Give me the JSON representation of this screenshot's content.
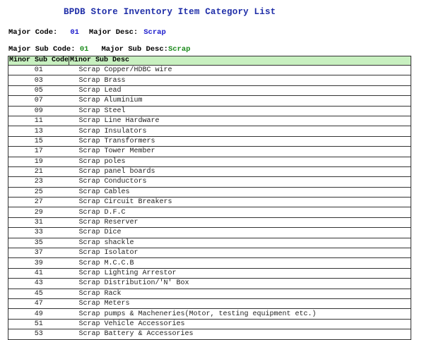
{
  "title": "BPDB Store Inventory Item Category List",
  "major": {
    "code_label": "Major Code:",
    "code": "01",
    "desc_label": "Major Desc:",
    "desc": "Scrap"
  },
  "major_sub": {
    "code_label": "Major Sub Code:",
    "code": "01",
    "desc_label": "Major Sub Desc:",
    "desc": "Scrap"
  },
  "table": {
    "headers": [
      "Minor Sub Code",
      "Minor Sub Desc"
    ],
    "rows": [
      {
        "code": "01",
        "desc": "Scrap Copper/HDBC wire"
      },
      {
        "code": "03",
        "desc": "Scrap Brass"
      },
      {
        "code": "05",
        "desc": "Scrap Lead"
      },
      {
        "code": "07",
        "desc": "Scrap Aluminium"
      },
      {
        "code": "09",
        "desc": "Scrap Steel"
      },
      {
        "code": "11",
        "desc": "Scrap Line Hardware"
      },
      {
        "code": "13",
        "desc": "Scrap Insulators"
      },
      {
        "code": "15",
        "desc": "Scrap Transformers"
      },
      {
        "code": "17",
        "desc": "Scrap Tower Member"
      },
      {
        "code": "19",
        "desc": "Scrap poles"
      },
      {
        "code": "21",
        "desc": "Scrap panel boards"
      },
      {
        "code": "23",
        "desc": "Scrap Conductors"
      },
      {
        "code": "25",
        "desc": "Scrap Cables"
      },
      {
        "code": "27",
        "desc": "Scrap Circuit Breakers"
      },
      {
        "code": "29",
        "desc": "Scrap D.F.C"
      },
      {
        "code": "31",
        "desc": "Scrap Reserver"
      },
      {
        "code": "33",
        "desc": "Scrap Dice"
      },
      {
        "code": "35",
        "desc": "Scrap shackle"
      },
      {
        "code": "37",
        "desc": "Scrap Isolator"
      },
      {
        "code": "39",
        "desc": "Scrap M.C.C.B"
      },
      {
        "code": "41",
        "desc": "Scrap Lighting Arrestor"
      },
      {
        "code": "43",
        "desc": "Scrap Distribution/'N' Box"
      },
      {
        "code": "45",
        "desc": "Scrap Rack"
      },
      {
        "code": "47",
        "desc": "Scrap Meters"
      },
      {
        "code": "49",
        "desc": "Scrap pumps & Macheneries(Motor, testing equipment etc.)"
      },
      {
        "code": "51",
        "desc": "Scrap Vehicle Accessories"
      },
      {
        "code": "53",
        "desc": "Scrap Battery & Accessories"
      }
    ]
  }
}
